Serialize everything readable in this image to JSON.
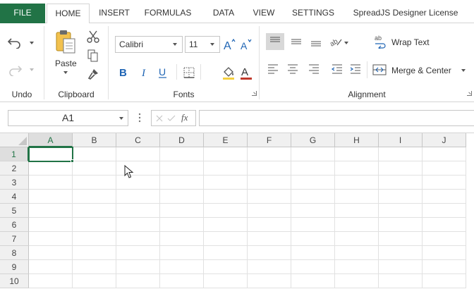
{
  "tabs": [
    {
      "id": "file",
      "label": "FILE"
    },
    {
      "id": "home",
      "label": "HOME",
      "active": true
    },
    {
      "id": "insert",
      "label": "INSERT"
    },
    {
      "id": "formulas",
      "label": "FORMULAS"
    },
    {
      "id": "data",
      "label": "DATA"
    },
    {
      "id": "view",
      "label": "VIEW"
    },
    {
      "id": "settings",
      "label": "SETTINGS"
    },
    {
      "id": "license",
      "label": "SpreadJS Designer License"
    }
  ],
  "ribbon": {
    "undo": {
      "label": "Undo"
    },
    "clipboard": {
      "label": "Clipboard",
      "paste_label": "Paste"
    },
    "fonts": {
      "label": "Fonts",
      "font_family": "Calibri",
      "font_size": "11"
    },
    "alignment": {
      "label": "Alignment",
      "wrap_text": "Wrap Text",
      "merge_center": "Merge & Center"
    }
  },
  "formula_bar": {
    "name_box": "A1",
    "fx_label": "fx",
    "formula": ""
  },
  "sheet": {
    "columns": [
      "A",
      "B",
      "C",
      "D",
      "E",
      "F",
      "G",
      "H",
      "I",
      "J"
    ],
    "rows": [
      "1",
      "2",
      "3",
      "4",
      "5",
      "6",
      "7",
      "8",
      "9",
      "10"
    ],
    "active_cell": "A1",
    "accent_color": "#217346"
  }
}
